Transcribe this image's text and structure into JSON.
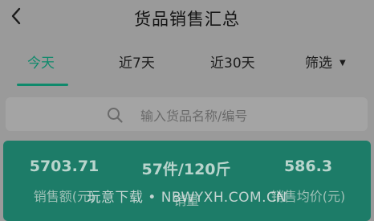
{
  "header": {
    "back_icon": "chevron-left-icon",
    "title": "货品销售汇总"
  },
  "tabs": [
    {
      "label": "今天",
      "active": true
    },
    {
      "label": "近7天",
      "active": false
    },
    {
      "label": "近30天",
      "active": false
    }
  ],
  "filter": {
    "label": "筛选",
    "icon": "caret-down-icon"
  },
  "search": {
    "icon": "search-icon",
    "placeholder": "输入货品名称/编号"
  },
  "summary": {
    "stats": [
      {
        "value": "5703.71",
        "label": "销售额(元)"
      },
      {
        "value": "57件/120斤",
        "label": "销量"
      },
      {
        "value": "586.3",
        "label": "销售均价(元)"
      }
    ]
  },
  "watermark": "玩意下载 • NBWYXH.COM.CN",
  "colors": {
    "accent": "#0f8a6c",
    "card_background": "#1d7c68",
    "page_background": "#9a9a9a"
  }
}
